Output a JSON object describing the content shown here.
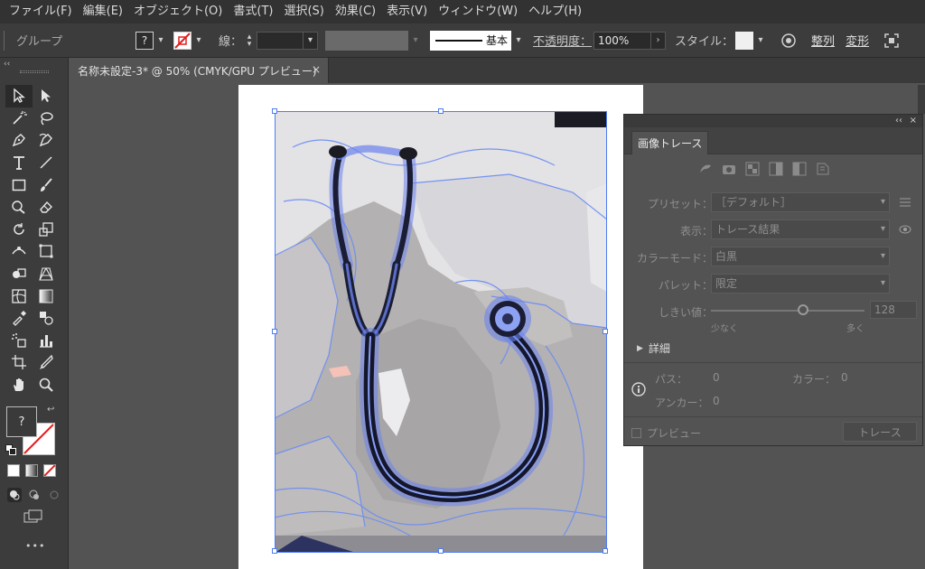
{
  "menu": [
    "ファイル(F)",
    "編集(E)",
    "オブジェクト(O)",
    "書式(T)",
    "選択(S)",
    "効果(C)",
    "表示(V)",
    "ウィンドウ(W)",
    "ヘルプ(H)"
  ],
  "controlbar": {
    "selection_type": "グループ",
    "fill_swatch": "?",
    "stroke_label": "線：",
    "brush_label": "基本",
    "opacity_label": "不透明度：",
    "opacity_value": "100%",
    "style_label": "スタイル：",
    "align_label": "整列",
    "transform_label": "変形"
  },
  "document_tab": {
    "title": "名称未設定-3* @ 50% (CMYK/GPU プレビュー)",
    "close": "×"
  },
  "toolbox": {
    "collapse": "‹‹",
    "fill_unknown": "?",
    "more": "•••"
  },
  "trace_panel": {
    "collapse": "‹‹",
    "close": "×",
    "tab": "画像トレース",
    "preset_label": "プリセット：",
    "preset_value": "［デフォルト］",
    "view_label": "表示：",
    "view_value": "トレース結果",
    "mode_label": "カラーモード：",
    "mode_value": "白黒",
    "palette_label": "パレット：",
    "palette_value": "限定",
    "threshold_label": "しきい値：",
    "threshold_value": "128",
    "threshold_min": "少なく",
    "threshold_max": "多く",
    "threshold_level": 0.6,
    "advanced_label": "詳細",
    "paths_label": "パス：",
    "paths_value": "0",
    "colors_label": "カラー：",
    "colors_value": "0",
    "anchors_label": "アンカー：",
    "anchors_value": "0",
    "preview_label": "プレビュー",
    "trace_button": "トレース"
  },
  "colors": {
    "selection": "#4d7cf2",
    "stroke_none": "#e02020"
  }
}
